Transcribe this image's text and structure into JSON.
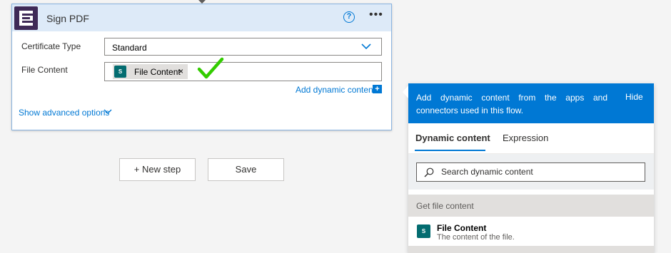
{
  "action_card": {
    "title": "Sign PDF",
    "help_icon": "?",
    "more_icon": "•••",
    "fields": {
      "certificate_type": {
        "label": "Certificate Type",
        "value": "Standard"
      },
      "file_content": {
        "label": "File Content",
        "token": {
          "icon_text": "S",
          "label": "File Content",
          "remove": "×"
        }
      }
    },
    "add_dynamic_label": "Add dynamic content",
    "add_dynamic_plus": "+",
    "show_advanced_label": "Show advanced options"
  },
  "flow_buttons": {
    "new_step_label": "+ New step",
    "save_label": "Save"
  },
  "dynamic_panel": {
    "description": "Add dynamic content from the apps and connectors used in this flow.",
    "hide_label": "Hide",
    "tabs": [
      {
        "label": "Dynamic content",
        "active": true
      },
      {
        "label": "Expression",
        "active": false
      }
    ],
    "search": {
      "placeholder": "Search dynamic content",
      "value": ""
    },
    "section_title": "Get file content",
    "items": [
      {
        "icon_text": "S",
        "title": "File Content",
        "description": "The content of the file."
      }
    ]
  },
  "colors": {
    "accent": "#0078d4",
    "header_bg": "#ddeaf8",
    "app_icon_bg": "#3f2a57",
    "sharepoint_icon": "#036c70",
    "checkmark": "#33cc00"
  },
  "icons": {
    "app": "document-sign-icon",
    "check": "checkmark-icon",
    "search": "search-icon",
    "chevron": "chevron-down-icon"
  }
}
